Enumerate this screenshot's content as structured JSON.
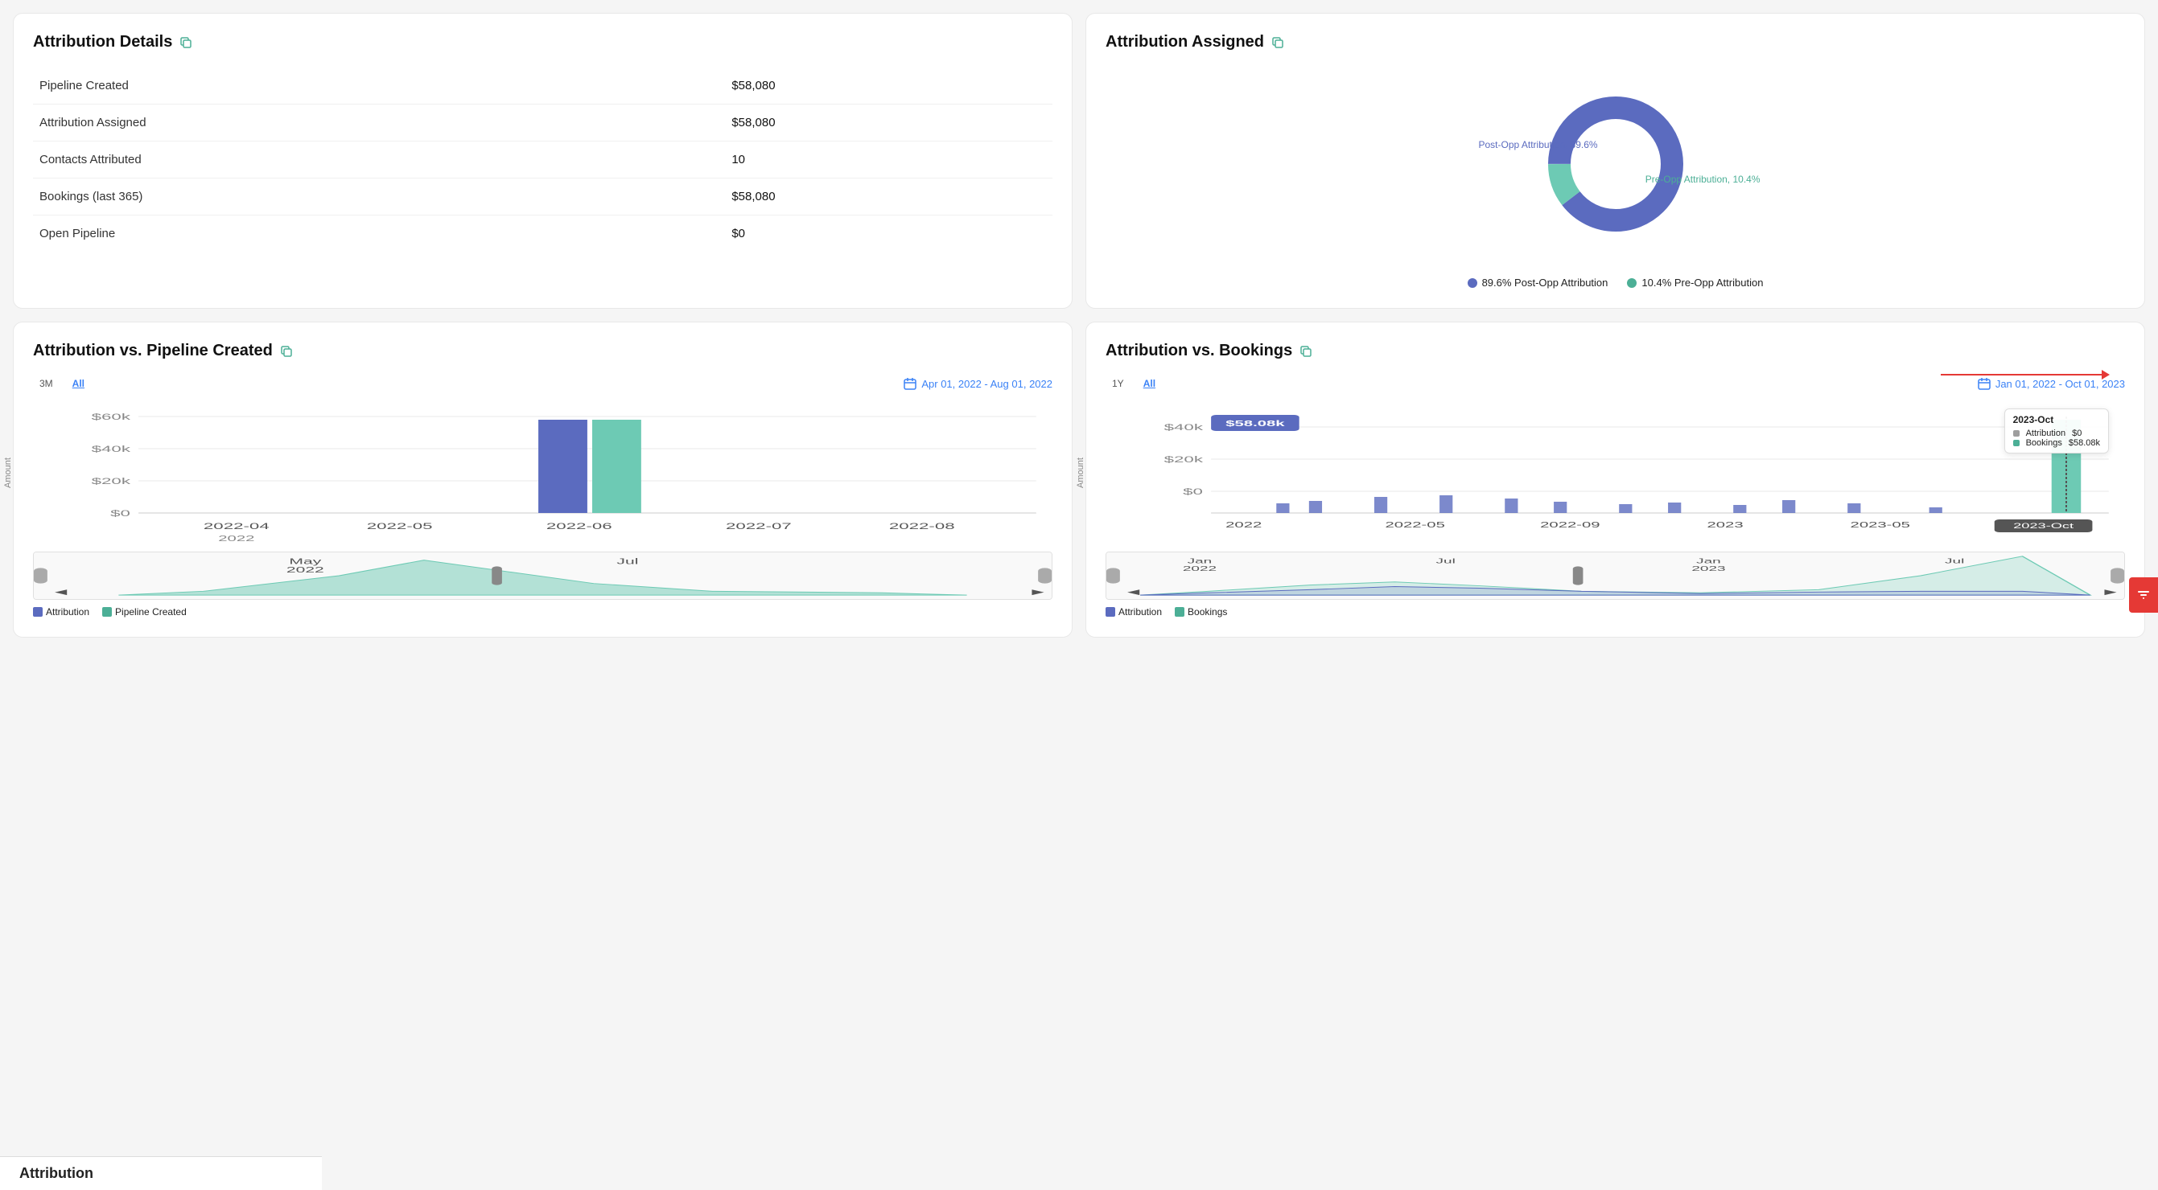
{
  "cards": {
    "attribution_details": {
      "title": "Attribution Details",
      "rows": [
        {
          "label": "Pipeline Created",
          "value": "$58,080"
        },
        {
          "label": "Attribution Assigned",
          "value": "$58,080"
        },
        {
          "label": "Contacts Attributed",
          "value": "10"
        },
        {
          "label": "Bookings (last 365)",
          "value": "$58,080"
        },
        {
          "label": "Open Pipeline",
          "value": "$0"
        }
      ]
    },
    "attribution_assigned": {
      "title": "Attribution Assigned",
      "post_opp_pct": 89.6,
      "pre_opp_pct": 10.4,
      "post_opp_label": "Post-Opp Attribution, 89.6%",
      "pre_opp_label": "Pre-Opp Attribution, 10.4%",
      "legend": [
        {
          "label": "89.6% Post-Opp Attribution",
          "color": "#5b6bbf"
        },
        {
          "label": "10.4% Pre-Opp Attribution",
          "color": "#4caf96"
        }
      ],
      "colors": {
        "post_opp": "#5b6bbf",
        "pre_opp": "#6dcab4"
      }
    },
    "attribution_vs_pipeline": {
      "title": "Attribution vs. Pipeline Created",
      "time_buttons": [
        "3M",
        "All"
      ],
      "active_time": "All",
      "date_range": "Apr 01, 2022 - Aug 01, 2022",
      "y_label": "Amount",
      "x_labels": [
        "2022-04",
        "2022-05",
        "2022-06",
        "2022-07",
        "2022-08"
      ],
      "y_ticks": [
        "$60k",
        "$40k",
        "$20k",
        "$0"
      ],
      "bottom_label": "2022",
      "minimap_labels": [
        "May\n2022",
        "Jul"
      ],
      "legend": [
        {
          "label": "Attribution",
          "color": "#5b6bbf"
        },
        {
          "label": "Pipeline Created",
          "color": "#4caf96"
        }
      ]
    },
    "attribution_vs_bookings": {
      "title": "Attribution vs. Bookings",
      "time_buttons": [
        "1Y",
        "All"
      ],
      "active_time": "All",
      "date_range": "Jan 01, 2022 - Oct 01, 2023",
      "y_label": "Amount",
      "x_labels": [
        "2022",
        "2022-05",
        "2022-09",
        "2023",
        "2023-05"
      ],
      "y_ticks": [
        "$40k",
        "$20k",
        "$0"
      ],
      "highlight_label": "$58.08k",
      "tooltip": {
        "title": "2023-Oct",
        "rows": [
          {
            "label": "Attribution",
            "value": "$0",
            "color": "#9e9e9e"
          },
          {
            "label": "Bookings",
            "value": "$58.08k",
            "color": "#4caf96"
          }
        ]
      },
      "minimap_labels": [
        "Jan\n2022",
        "Jul",
        "Jan\n2023",
        "Jul"
      ],
      "legend": [
        {
          "label": "Attribution",
          "color": "#5b6bbf"
        },
        {
          "label": "Bookings",
          "color": "#4caf96"
        }
      ]
    }
  },
  "bottom_tab": {
    "label": "Attribution"
  },
  "filter_button": {
    "label": "⊞"
  }
}
